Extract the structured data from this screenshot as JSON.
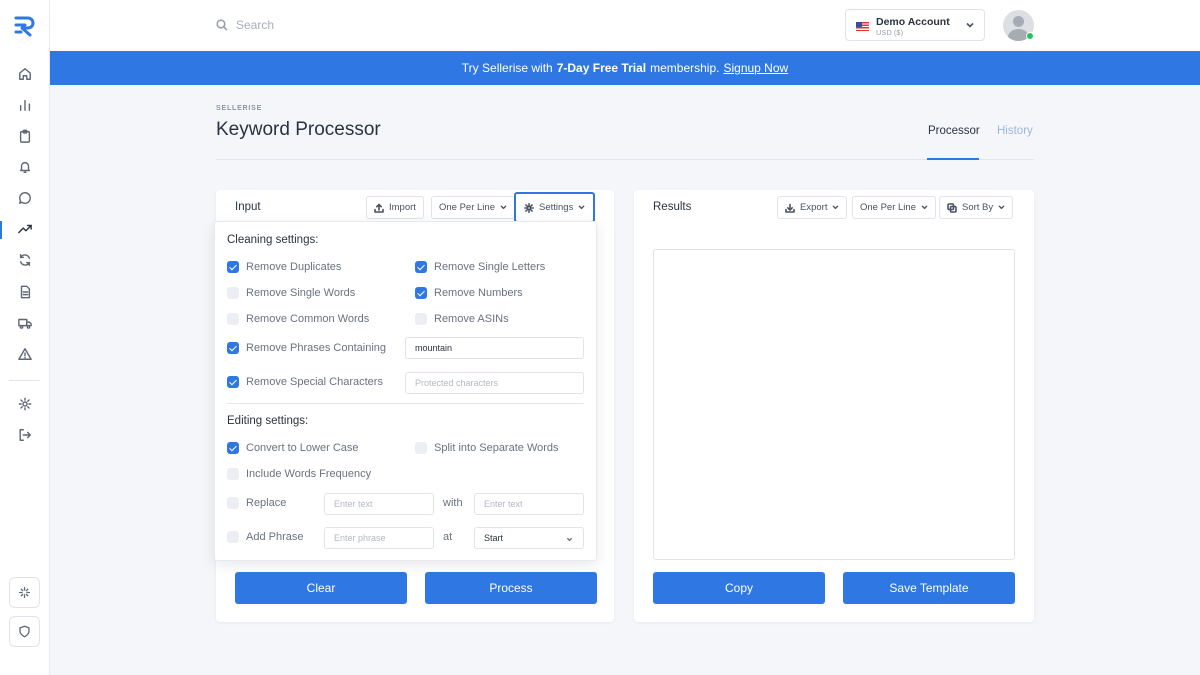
{
  "sidebar": {
    "logo": "sellerise-logo",
    "items": [
      "home-icon",
      "bar-chart-icon",
      "clipboard-icon",
      "bell-icon",
      "chat-icon",
      "trending-icon",
      "refresh-icon",
      "document-icon",
      "truck-icon",
      "warning-icon",
      "gear-icon",
      "logout-icon"
    ],
    "active_item": "trending-icon",
    "bottom": [
      "sparkle-icon",
      "shield-icon"
    ]
  },
  "topbar": {
    "search_placeholder": "Search",
    "account_name": "Demo Account",
    "account_currency": "USD ($)"
  },
  "banner": {
    "prefix": "Try Sellerise with",
    "highlight": "7-Day Free Trial",
    "suffix": "membership.",
    "link": "Signup Now"
  },
  "page": {
    "breadcrumb": "SELLERISE",
    "title": "Keyword Processor",
    "tabs": [
      {
        "label": "Processor",
        "active": true
      },
      {
        "label": "History",
        "active": false
      }
    ]
  },
  "input_card": {
    "label": "Input",
    "import_label": "Import",
    "format_label": "One Per Line",
    "settings_label": "Settings",
    "clear_label": "Clear",
    "process_label": "Process"
  },
  "results_card": {
    "label": "Results",
    "export_label": "Export",
    "format_label": "One Per Line",
    "sort_label": "Sort By",
    "copy_label": "Copy",
    "save_label": "Save Template"
  },
  "settings": {
    "cleaning_title": "Cleaning settings:",
    "cleaning": [
      {
        "label": "Remove Duplicates",
        "checked": true
      },
      {
        "label": "Remove Single Letters",
        "checked": true
      },
      {
        "label": "Remove Single Words",
        "checked": false
      },
      {
        "label": "Remove Numbers",
        "checked": true
      },
      {
        "label": "Remove Common Words",
        "checked": false
      },
      {
        "label": "Remove ASINs",
        "checked": false
      },
      {
        "label": "Remove Phrases Containing",
        "checked": true,
        "value": "mountain"
      },
      {
        "label": "Remove Special Characters",
        "checked": true,
        "placeholder": "Protected characters"
      }
    ],
    "editing_title": "Editing settings:",
    "editing": [
      {
        "label": "Convert to Lower Case",
        "checked": true
      },
      {
        "label": "Split into Separate Words",
        "checked": false
      },
      {
        "label": "Include Words Frequency",
        "checked": false
      },
      {
        "label": "Replace",
        "checked": false,
        "placeholder": "Enter text",
        "with_word": "with",
        "with_placeholder": "Enter text"
      },
      {
        "label": "Add Phrase",
        "checked": false,
        "placeholder": "Enter phrase",
        "at_word": "at",
        "at_value": "Start"
      }
    ]
  },
  "colors": {
    "accent": "#2f78e3",
    "background": "#f4f6fa",
    "online": "#22c55e"
  }
}
